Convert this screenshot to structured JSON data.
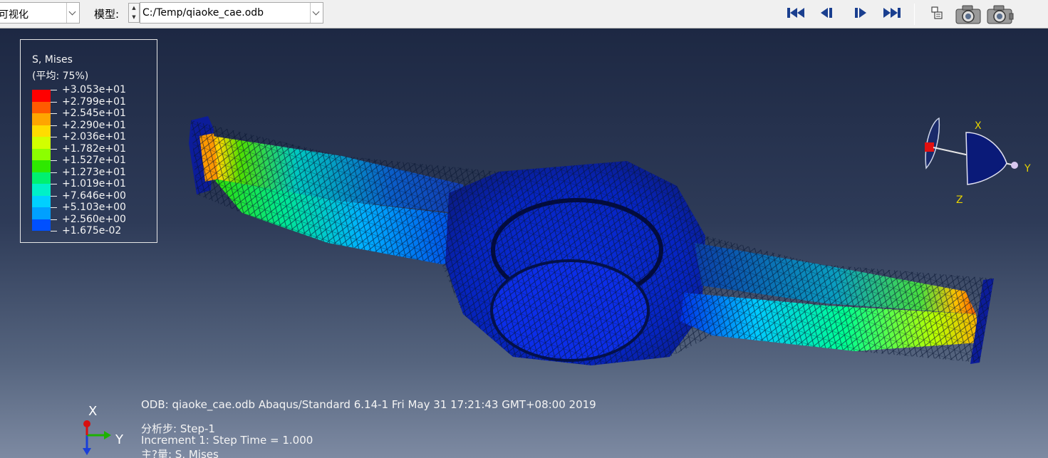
{
  "toolbar": {
    "module_combo": "可视化",
    "model_label": "模型:",
    "model_path": "C:/Temp/qiaoke_cae.odb",
    "icons": [
      "first-frame-icon",
      "previous-frame-icon",
      "next-frame-icon",
      "last-frame-icon",
      "frame-selector-icon",
      "camera-icon",
      "camera-movie-icon"
    ]
  },
  "legend": {
    "title": "S, Mises",
    "subtitle": "(平均: 75%)",
    "values": [
      "+3.053e+01",
      "+2.799e+01",
      "+2.545e+01",
      "+2.290e+01",
      "+2.036e+01",
      "+1.782e+01",
      "+1.527e+01",
      "+1.273e+01",
      "+1.019e+01",
      "+7.646e+00",
      "+5.103e+00",
      "+2.560e+00",
      "+1.675e-02"
    ],
    "colors": [
      "#ff0000",
      "#ff5a00",
      "#ffa500",
      "#ffdc00",
      "#d2ff00",
      "#8cff00",
      "#2ee800",
      "#00f070",
      "#00f0c8",
      "#00d0ff",
      "#00a0ff",
      "#0050ff",
      "#0010ee"
    ]
  },
  "triad": {
    "x_label": "X",
    "y_label": "Y",
    "z_label": "Z"
  },
  "info": {
    "line1": "ODB: qiaoke_cae.odb    Abaqus/Standard 6.14-1    Fri May 31 17:21:43 GMT+08:00 2019",
    "line2": "分析步: Step-1",
    "line3": "Increment     1: Step Time =    1.000",
    "line4": "主?量: S, Mises"
  },
  "corner_axes": {
    "x_label": "X",
    "y_label": "Y"
  },
  "colors": {
    "viewport_top": "#1d2843",
    "viewport_bottom": "#7d8aa2",
    "mesh_line": "#0a1630"
  }
}
